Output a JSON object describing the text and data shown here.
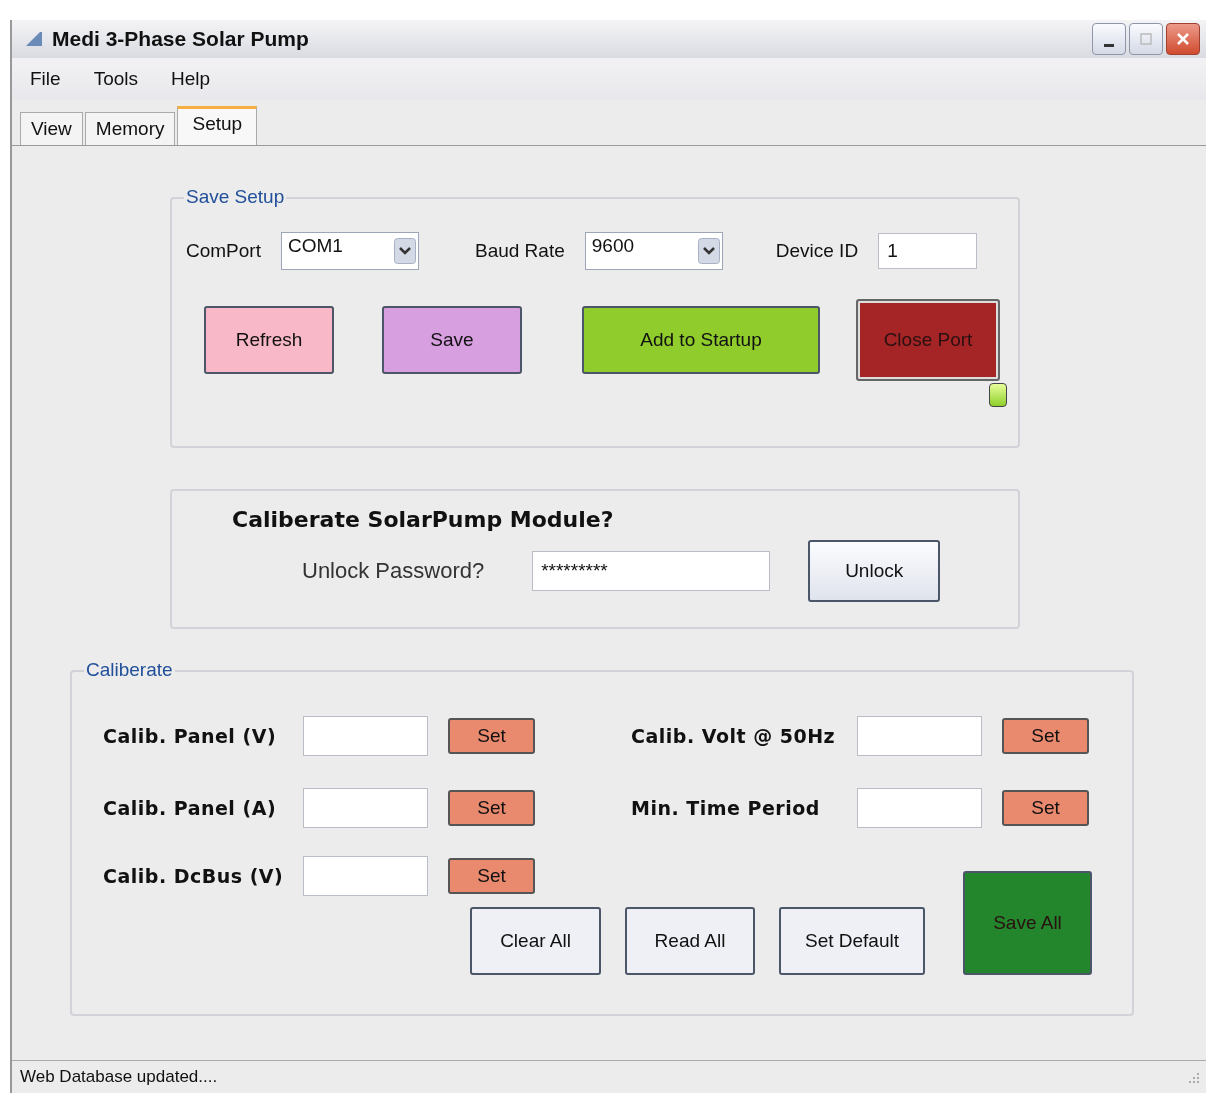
{
  "window": {
    "title": "Medi 3-Phase Solar Pump"
  },
  "menu": [
    "File",
    "Tools",
    "Help"
  ],
  "tabs": [
    {
      "label": "View",
      "selected": false
    },
    {
      "label": "Memory",
      "selected": false
    },
    {
      "label": "Setup",
      "selected": true
    }
  ],
  "save_setup": {
    "title": "Save Setup",
    "comport": {
      "label": "ComPort",
      "value": "COM1"
    },
    "baud_rate": {
      "label": "Baud Rate",
      "value": "9600"
    },
    "device_id": {
      "label": "Device ID",
      "value": "1"
    },
    "buttons": [
      {
        "label": "Refresh",
        "color": "#f9b8c8"
      },
      {
        "label": "Save",
        "color": "#d79ee0"
      },
      {
        "label": "Add to Startup",
        "color": "#8fcc2c"
      },
      {
        "label": "Close Port",
        "color": "#a52426"
      }
    ],
    "port_led": {
      "on": true
    }
  },
  "unlock": {
    "title": "Caliberate SolarPump Module?",
    "label": "Unlock Password?",
    "value": "*********",
    "button": "Unlock"
  },
  "calibrate": {
    "title": "Caliberate",
    "rows": [
      {
        "label": "Calib. Panel (V)",
        "button": "Set"
      },
      {
        "label": "Calib. Volt @ 50Hz",
        "button": "Set"
      },
      {
        "label": "Calib. Panel (A)",
        "button": "Set"
      },
      {
        "label": "Min. Time Period",
        "button": "Set"
      },
      {
        "label": "Calib. DcBus (V)",
        "button": "Set"
      }
    ],
    "buttons": [
      {
        "label": "Clear All",
        "color": "#eef0f6"
      },
      {
        "label": "Read All",
        "color": "#eef0f6"
      },
      {
        "label": "Set Default",
        "color": "#eef0f6"
      },
      {
        "label": "Save All",
        "color": "#23862c"
      }
    ]
  },
  "status_bar": {
    "text": "Web Database updated...."
  }
}
